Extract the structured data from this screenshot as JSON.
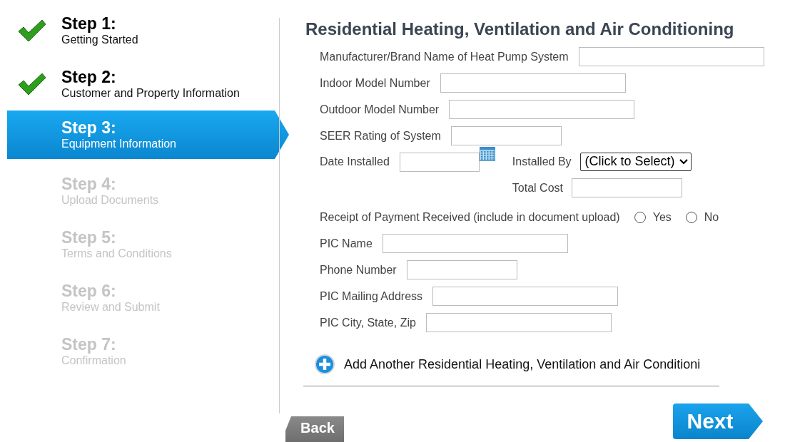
{
  "steps": [
    {
      "title": "Step 1:",
      "subtitle": "Getting Started",
      "completed": true,
      "selected": false,
      "disabled": false
    },
    {
      "title": "Step 2:",
      "subtitle": "Customer and Property Information",
      "completed": true,
      "selected": false,
      "disabled": false
    },
    {
      "title": "Step 3:",
      "subtitle": "Equipment Information",
      "completed": false,
      "selected": true,
      "disabled": false
    },
    {
      "title": "Step 4:",
      "subtitle": "Upload Documents",
      "completed": false,
      "selected": false,
      "disabled": true
    },
    {
      "title": "Step 5:",
      "subtitle": "Terms and Conditions",
      "completed": false,
      "selected": false,
      "disabled": true
    },
    {
      "title": "Step 6:",
      "subtitle": "Review and Submit",
      "completed": false,
      "selected": false,
      "disabled": true
    },
    {
      "title": "Step 7:",
      "subtitle": "Confirmation",
      "completed": false,
      "selected": false,
      "disabled": true
    }
  ],
  "section_title": "Residential Heating, Ventilation and Air Conditioning",
  "equipment_fields": [
    {
      "label": "Manufacturer/Brand Name of Heat Pump System"
    },
    {
      "label": "Indoor Model Number"
    },
    {
      "label": "Outdoor Model Number"
    },
    {
      "label": "SEER Rating of System"
    }
  ],
  "installation": {
    "date_label": "Date Installed",
    "installed_by_label": "Installed By",
    "installed_by_value": "(Click to Select)",
    "total_cost_label": "Total Cost"
  },
  "receipt": {
    "label": "Receipt of Payment Received (include in document upload)",
    "options": [
      {
        "label": "Yes",
        "selected": false
      },
      {
        "label": "No",
        "selected": false
      }
    ]
  },
  "contact_fields": [
    {
      "label": "PIC Name"
    },
    {
      "label": "Phone Number"
    },
    {
      "label": "PIC Mailing Address"
    },
    {
      "label": "PIC City, State, Zip"
    }
  ],
  "add_another": "Add Another Residential Heating, Ventilation and Air Conditioni",
  "buttons": {
    "back": "Back",
    "next": "Next"
  }
}
